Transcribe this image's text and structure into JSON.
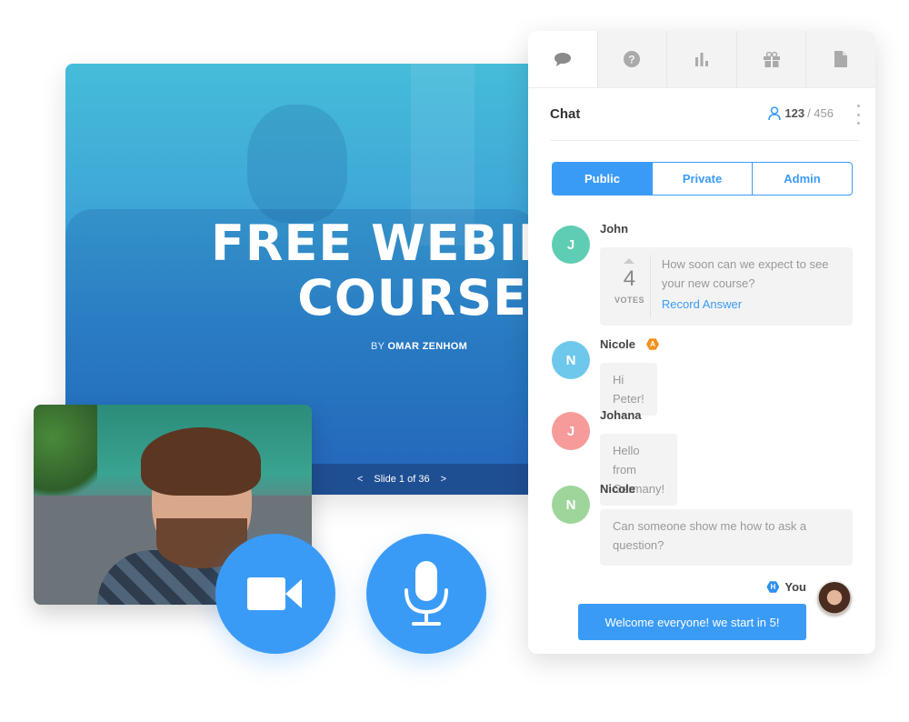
{
  "slide": {
    "title_line1": "FREE WEBIN",
    "title_line2": "COURSE",
    "byline_prefix": "BY",
    "byline_author": "OMAR ZENHOM",
    "nav_prev": "<",
    "nav_label": "Slide 1 of 36",
    "nav_next": ">"
  },
  "controls": {
    "video_icon": "video-camera-icon",
    "mic_icon": "microphone-icon"
  },
  "panel": {
    "tabs": [
      {
        "icon": "chat-bubble-icon",
        "active": true
      },
      {
        "icon": "question-icon",
        "active": false
      },
      {
        "icon": "poll-chart-icon",
        "active": false
      },
      {
        "icon": "gift-icon",
        "active": false
      },
      {
        "icon": "document-icon",
        "active": false
      }
    ],
    "title": "Chat",
    "attendees_current": "123",
    "attendees_separator": "/ 456",
    "segments": [
      "Public",
      "Private",
      "Admin"
    ],
    "active_segment": "Public",
    "messages": [
      {
        "initial": "J",
        "name": "John",
        "avatar_color": "#5ecdb3",
        "votes": "4",
        "votes_label": "VOTES",
        "text": "How soon can we expect to see your new course?",
        "action": "Record Answer"
      },
      {
        "initial": "N",
        "name": "Nicole",
        "avatar_color": "#6ec8ec",
        "badge": "A",
        "badge_color": "#f5901e",
        "text": "Hi Peter!"
      },
      {
        "initial": "J",
        "name": "Johana",
        "avatar_color": "#f79a9a",
        "text": "Hello from Germany!"
      },
      {
        "initial": "N",
        "name": "Nicole",
        "avatar_color": "#9ed59b",
        "text": "Can someone show me how to ask a question?"
      }
    ],
    "self": {
      "badge": "H",
      "badge_color": "#2f8ff0",
      "name": "You",
      "text": "Welcome everyone! we start in 5!"
    }
  },
  "colors": {
    "accent": "#3a9bf7",
    "slide_nav": "#1f4f93"
  }
}
